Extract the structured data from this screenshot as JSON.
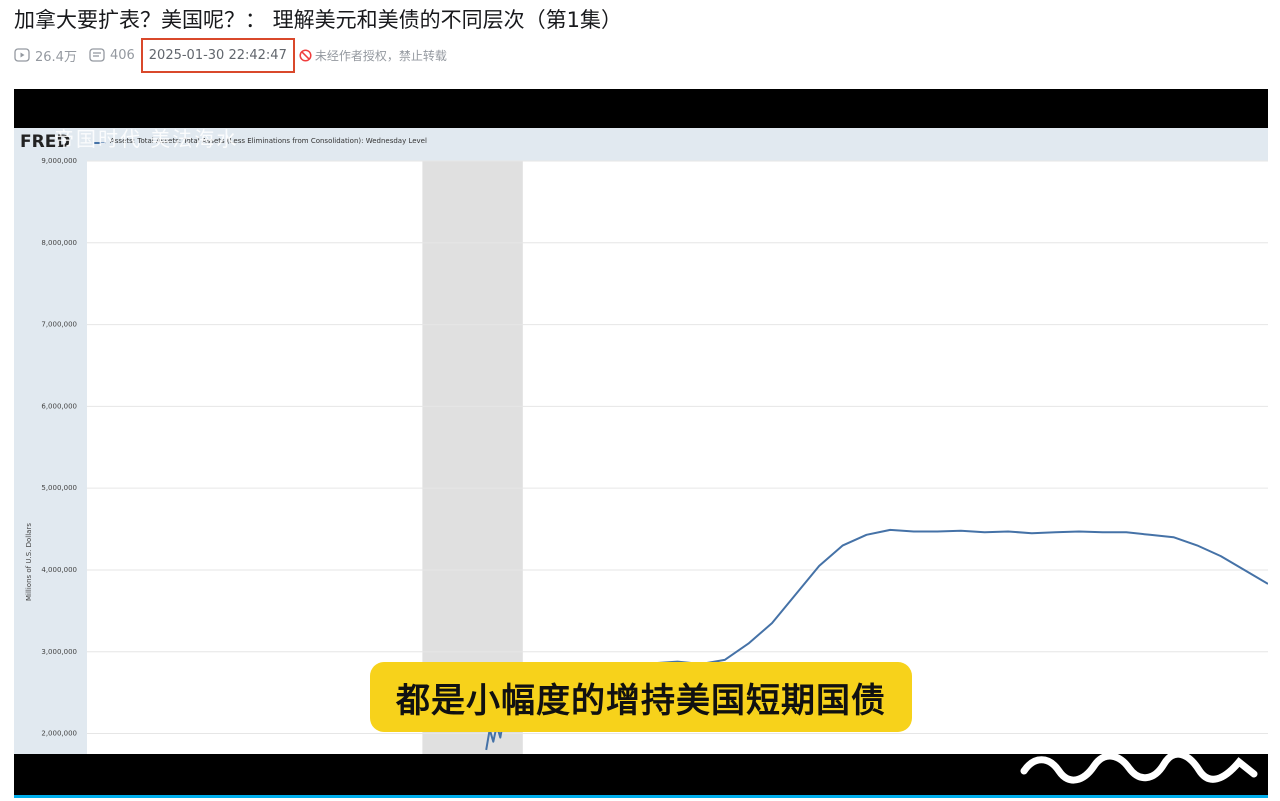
{
  "video": {
    "title": "加拿大要扩表？美国呢？： 理解美元和美债的不同层次（第1集）",
    "views": "26.4万",
    "danmaku_count": "406",
    "pubdate": "2025-01-30 22:42:47",
    "copyright_notice": "未经作者授权，禁止转载"
  },
  "icons": {
    "views": "play-count-icon",
    "danmaku": "danmaku-icon",
    "copyright": "no-repost-icon"
  },
  "colors": {
    "highlight_border": "#d9482b",
    "subtitle_bg": "#f7d21b",
    "series_line": "#4572a7",
    "progress": "#00aeec"
  },
  "player": {
    "watermark": "帝国时代 美法海水",
    "subtitle": "都是小幅度的增持美国短期国债"
  },
  "chart_data": {
    "type": "line",
    "logo": "FRED",
    "legend": "Assets: Total Assets: Total Assets (Less Eliminations from Consolidation): Wednesday Level",
    "ylabel": "Millions of U.S. Dollars",
    "yticks": [
      "9,000,000",
      "8,000,000",
      "7,000,000",
      "6,000,000",
      "5,000,000",
      "4,000,000",
      "3,000,000",
      "2,000,000"
    ],
    "tick_values": [
      9000000,
      8000000,
      7000000,
      6000000,
      5000000,
      4000000,
      3000000,
      2000000
    ],
    "ylim": [
      1750000,
      9000000
    ],
    "xlim": [
      0,
      100
    ],
    "recession_band": [
      28.4,
      36.9
    ],
    "series": [
      {
        "x": [
          33.8,
          34.1,
          34.4,
          34.7,
          35.0,
          35.3,
          35.6,
          46.0,
          48.0,
          50.0,
          52.0,
          54.0,
          56.0,
          58.0,
          60.0,
          62.0,
          64.0,
          66.0,
          68.0,
          70.0,
          72.0,
          74.0,
          76.0,
          78.0,
          80.0,
          82.0,
          84.0,
          86.0,
          88.0,
          90.0,
          92.0,
          94.0,
          96.0,
          98.0,
          100.0
        ],
        "y": [
          1800000,
          2050000,
          1900000,
          2100000,
          1950000,
          2200000,
          2150000,
          2850000,
          2860000,
          2880000,
          2850000,
          2900000,
          3100000,
          3350000,
          3700000,
          4050000,
          4300000,
          4430000,
          4490000,
          4470000,
          4470000,
          4480000,
          4460000,
          4470000,
          4450000,
          4460000,
          4470000,
          4460000,
          4460000,
          4430000,
          4400000,
          4300000,
          4170000,
          4000000,
          3830000
        ]
      }
    ]
  }
}
